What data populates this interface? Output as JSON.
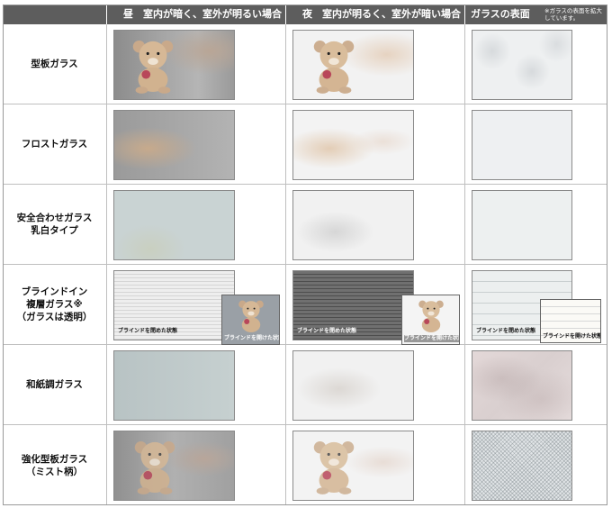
{
  "header": {
    "day": "昼　室内が暗く、室外が明るい場合",
    "night": "夜　室内が明るく、室外が暗い場合",
    "surface": "ガラスの表面",
    "surface_note": "※ガラスの表面を拡大しています。"
  },
  "rows": [
    {
      "label": "型板ガラス"
    },
    {
      "label": "フロストガラス"
    },
    {
      "label": "安全合わせガラス\n乳白タイプ"
    },
    {
      "label": "ブラインドイン\n複層ガラス※\n（ガラスは透明）",
      "caption_closed": "ブラインドを閉めた状態",
      "caption_open": "ブラインドを開けた状態"
    },
    {
      "label": "和紙調ガラス"
    },
    {
      "label": "強化型板ガラス\n（ミスト柄）"
    }
  ],
  "colors": {
    "header_bg": "#5d5d5d",
    "grid": "#bfbfbf"
  }
}
